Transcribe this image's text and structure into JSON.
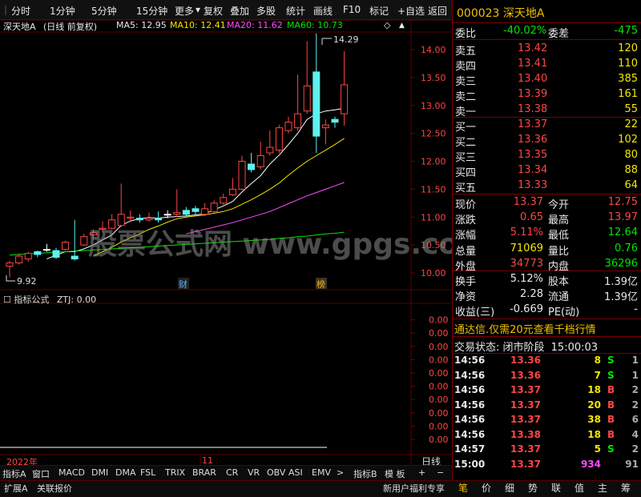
{
  "toolbar": {
    "periods": [
      "分时",
      "1分钟",
      "5分钟",
      "15分钟",
      "更多"
    ],
    "buttons": [
      "复权",
      "叠加",
      "多股",
      "统计",
      "画线",
      "F10",
      "标记",
      "+自选",
      "返回"
    ]
  },
  "chart_header": {
    "stock": "深天地A",
    "mode": "(日线 前复权)",
    "ma5": "MA5: 12.95",
    "ma10": "MA10: 12.41",
    "ma20": "MA20: 11.62",
    "ma60": "MA60: 10.73",
    "diamond": "◇",
    "arrow": "▲"
  },
  "annotations": {
    "high": "14.29",
    "low": "9.92",
    "finance_mark": "财",
    "list_mark": "榜"
  },
  "watermark": "股票公式网 www.gpgs.com",
  "price_axis": [
    "14.00",
    "13.50",
    "13.00",
    "12.50",
    "12.00",
    "11.50",
    "11.00",
    "10.50",
    "10.00"
  ],
  "indicator": {
    "title": "指标公式",
    "value_label": "ZTJ: 0.00",
    "axis": [
      "0.00",
      "0.00",
      "0.00",
      "0.00",
      "0.00",
      "0.00",
      "0.00",
      "0.00",
      "0.00",
      "0.00"
    ]
  },
  "date_axis": {
    "year": "2022年",
    "month": "11",
    "period": "日线"
  },
  "indicator_tabs": [
    "指标A",
    "窗口",
    "MACD",
    "DMI",
    "DMA",
    "FSL",
    "TRIX",
    "BRAR",
    "CR",
    "VR",
    "OBV",
    "ASI",
    "EMV",
    ">",
    "指标B",
    "模 板",
    "+",
    "−"
  ],
  "bottom_bar": {
    "left": [
      "扩展A",
      "关联报价"
    ],
    "promo": "新用户福利专享",
    "tabs": [
      "笔",
      "价",
      "细",
      "势",
      "联",
      "值",
      "主",
      "筹"
    ]
  },
  "chart_data": {
    "type": "candlestick",
    "title": "深天地A (日线 前复权)",
    "ylim": [
      9.8,
      14.5
    ],
    "candles": [
      {
        "o": 10.12,
        "c": 10.18,
        "h": 10.22,
        "l": 9.92
      },
      {
        "o": 10.18,
        "c": 10.3,
        "h": 10.35,
        "l": 10.15
      },
      {
        "o": 10.25,
        "c": 10.35,
        "h": 10.38,
        "l": 10.2
      },
      {
        "o": 10.38,
        "c": 10.33,
        "h": 10.4,
        "l": 10.28
      },
      {
        "o": 10.42,
        "c": 10.42,
        "h": 10.52,
        "l": 10.38
      },
      {
        "o": 10.4,
        "c": 10.28,
        "h": 10.45,
        "l": 10.25
      },
      {
        "o": 10.42,
        "c": 10.55,
        "h": 10.58,
        "l": 10.4
      },
      {
        "o": 10.3,
        "c": 10.25,
        "h": 10.95,
        "l": 10.22
      },
      {
        "o": 10.5,
        "c": 10.65,
        "h": 10.7,
        "l": 10.48
      },
      {
        "o": 10.68,
        "c": 10.72,
        "h": 10.78,
        "l": 10.6
      },
      {
        "o": 10.78,
        "c": 10.8,
        "h": 10.92,
        "l": 10.72
      },
      {
        "o": 10.8,
        "c": 10.95,
        "h": 11.05,
        "l": 10.78
      },
      {
        "o": 10.85,
        "c": 11.05,
        "h": 11.6,
        "l": 10.82
      },
      {
        "o": 10.98,
        "c": 11.0,
        "h": 11.12,
        "l": 10.92
      },
      {
        "o": 10.98,
        "c": 10.95,
        "h": 11.05,
        "l": 10.9
      },
      {
        "o": 10.95,
        "c": 10.98,
        "h": 11.08,
        "l": 10.92
      },
      {
        "o": 10.98,
        "c": 10.95,
        "h": 11.1,
        "l": 10.9
      },
      {
        "o": 11.05,
        "c": 11.05,
        "h": 11.12,
        "l": 10.98
      },
      {
        "o": 11.05,
        "c": 11.08,
        "h": 11.5,
        "l": 11.0
      },
      {
        "o": 11.12,
        "c": 11.05,
        "h": 11.18,
        "l": 11.02
      },
      {
        "o": 11.15,
        "c": 11.1,
        "h": 11.2,
        "l": 11.05
      },
      {
        "o": 11.05,
        "c": 11.15,
        "h": 11.25,
        "l": 11.02
      },
      {
        "o": 11.1,
        "c": 11.25,
        "h": 11.3,
        "l": 11.08
      },
      {
        "o": 11.25,
        "c": 11.35,
        "h": 11.42,
        "l": 11.22
      },
      {
        "o": 11.4,
        "c": 11.5,
        "h": 11.7,
        "l": 11.38
      },
      {
        "o": 11.5,
        "c": 12.0,
        "h": 12.1,
        "l": 11.48
      },
      {
        "o": 11.95,
        "c": 11.85,
        "h": 12.15,
        "l": 11.8
      },
      {
        "o": 11.9,
        "c": 12.1,
        "h": 12.35,
        "l": 11.85
      },
      {
        "o": 12.15,
        "c": 12.25,
        "h": 12.55,
        "l": 12.1
      },
      {
        "o": 12.2,
        "c": 12.6,
        "h": 12.65,
        "l": 12.15
      },
      {
        "o": 12.55,
        "c": 12.7,
        "h": 12.8,
        "l": 12.5
      },
      {
        "o": 12.6,
        "c": 12.85,
        "h": 13.55,
        "l": 12.55
      },
      {
        "o": 12.9,
        "c": 13.35,
        "h": 14.15,
        "l": 12.85
      },
      {
        "o": 13.6,
        "c": 12.45,
        "h": 14.29,
        "l": 12.15
      },
      {
        "o": 12.6,
        "c": 12.65,
        "h": 12.75,
        "l": 12.3
      },
      {
        "o": 12.75,
        "c": 12.7,
        "h": 12.8,
        "l": 12.6
      },
      {
        "o": 12.85,
        "c": 13.37,
        "h": 13.97,
        "l": 12.64
      }
    ],
    "ma": [
      {
        "name": "MA5",
        "color": "#ffffff",
        "values": [
          null,
          null,
          null,
          null,
          10.25,
          10.32,
          10.38,
          10.38,
          10.43,
          10.5,
          10.59,
          10.68,
          10.85,
          10.93,
          10.97,
          10.99,
          10.98,
          11.0,
          11.01,
          11.02,
          11.04,
          11.06,
          11.13,
          11.2,
          11.28,
          11.45,
          11.6,
          11.74,
          11.95,
          12.11,
          12.3,
          12.5,
          12.75,
          12.85,
          12.9,
          12.92,
          12.95
        ]
      },
      {
        "name": "MA10",
        "color": "#f2e600",
        "values": [
          null,
          null,
          null,
          null,
          null,
          null,
          null,
          null,
          null,
          10.3,
          10.38,
          10.46,
          10.55,
          10.63,
          10.7,
          10.78,
          10.84,
          10.91,
          10.97,
          11.0,
          11.02,
          11.04,
          11.07,
          11.1,
          11.15,
          11.23,
          11.31,
          11.4,
          11.5,
          11.61,
          11.75,
          11.88,
          12.0,
          12.1,
          12.2,
          12.3,
          12.41
        ]
      },
      {
        "name": "MA20",
        "color": "#ff4dff",
        "values": [
          null,
          null,
          null,
          null,
          null,
          null,
          null,
          null,
          null,
          null,
          null,
          null,
          null,
          null,
          null,
          null,
          null,
          null,
          null,
          10.7,
          10.74,
          10.78,
          10.82,
          10.86,
          10.9,
          10.95,
          11.0,
          11.05,
          11.1,
          11.17,
          11.24,
          11.31,
          11.38,
          11.44,
          11.5,
          11.56,
          11.62
        ]
      },
      {
        "name": "MA60",
        "color": "#00e600",
        "values": [
          10.32,
          10.33,
          10.34,
          10.35,
          10.36,
          10.37,
          10.38,
          10.39,
          10.4,
          10.41,
          10.42,
          10.43,
          10.44,
          10.45,
          10.46,
          10.47,
          10.48,
          10.49,
          10.5,
          10.51,
          10.52,
          10.53,
          10.54,
          10.55,
          10.56,
          10.57,
          10.58,
          10.59,
          10.6,
          10.62,
          10.63,
          10.65,
          10.66,
          10.68,
          10.7,
          10.71,
          10.73
        ]
      }
    ]
  },
  "quote": {
    "code": "000023",
    "name": "深天地A",
    "webi_label": "委比",
    "webi_value": "-40.02%",
    "weicha_label": "委差",
    "weicha_value": "-475",
    "asks": [
      {
        "label": "卖五",
        "price": "13.42",
        "vol": "120"
      },
      {
        "label": "卖四",
        "price": "13.41",
        "vol": "110"
      },
      {
        "label": "卖三",
        "price": "13.40",
        "vol": "385"
      },
      {
        "label": "卖二",
        "price": "13.39",
        "vol": "161"
      },
      {
        "label": "卖一",
        "price": "13.38",
        "vol": "55"
      }
    ],
    "bids": [
      {
        "label": "买一",
        "price": "13.37",
        "vol": "22"
      },
      {
        "label": "买二",
        "price": "13.36",
        "vol": "102"
      },
      {
        "label": "买三",
        "price": "13.35",
        "vol": "80"
      },
      {
        "label": "买四",
        "price": "13.34",
        "vol": "88"
      },
      {
        "label": "买五",
        "price": "13.33",
        "vol": "64"
      }
    ],
    "stats": [
      {
        "l1": "现价",
        "v1": "13.37",
        "c1": "red",
        "l2": "今开",
        "v2": "12.75",
        "c2": "red"
      },
      {
        "l1": "涨跌",
        "v1": "0.65",
        "c1": "red",
        "l2": "最高",
        "v2": "13.97",
        "c2": "red"
      },
      {
        "l1": "涨幅",
        "v1": "5.11%",
        "c1": "red",
        "l2": "最低",
        "v2": "12.64",
        "c2": "green"
      },
      {
        "l1": "总量",
        "v1": "71069",
        "c1": "yellow",
        "l2": "量比",
        "v2": "0.76",
        "c2": "green"
      },
      {
        "l1": "外盘",
        "v1": "34773",
        "c1": "red",
        "l2": "内盘",
        "v2": "36296",
        "c2": "green"
      }
    ],
    "stats2": [
      {
        "l1": "换手",
        "v1": "5.12%",
        "c1": "white",
        "l2": "股本",
        "v2": "1.39亿",
        "c2": "white"
      },
      {
        "l1": "净资",
        "v1": "2.28",
        "c1": "white",
        "l2": "流通",
        "v2": "1.39亿",
        "c2": "white"
      },
      {
        "l1": "收益(三)",
        "v1": "-0.669",
        "c1": "white",
        "l2": "PE(动)",
        "v2": "-",
        "c2": "white"
      }
    ],
    "promo": "通达信.仅需20元查看千档行情",
    "trade_status_label": "交易状态: 闭市阶段",
    "trade_status_time": "15:00:03",
    "ticks": [
      {
        "time": "14:56",
        "price": "13.36",
        "vol": "8",
        "side": "S",
        "n": "1"
      },
      {
        "time": "14:56",
        "price": "13.36",
        "vol": "7",
        "side": "S",
        "n": "1"
      },
      {
        "time": "14:56",
        "price": "13.37",
        "vol": "18",
        "side": "B",
        "n": "2"
      },
      {
        "time": "14:56",
        "price": "13.37",
        "vol": "20",
        "side": "B",
        "n": "2"
      },
      {
        "time": "14:56",
        "price": "13.37",
        "vol": "38",
        "side": "B",
        "n": "6"
      },
      {
        "time": "14:56",
        "price": "13.38",
        "vol": "18",
        "side": "B",
        "n": "4"
      },
      {
        "time": "14:57",
        "price": "13.37",
        "vol": "5",
        "side": "S",
        "n": "2"
      },
      {
        "time": "15:00",
        "price": "13.37",
        "vol": "934",
        "side": "",
        "n": "91"
      }
    ]
  }
}
